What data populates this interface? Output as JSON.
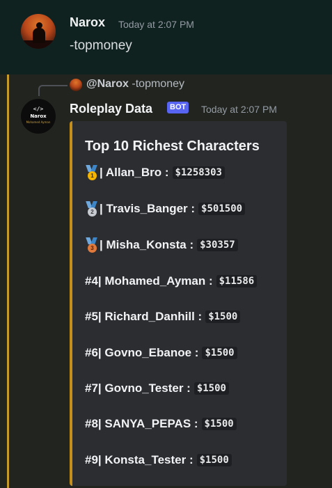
{
  "message1": {
    "author": "Narox",
    "timestamp": "Today at 2:07 PM",
    "content": "-topmoney"
  },
  "message2": {
    "reply": {
      "author": "@Narox",
      "content": "-topmoney"
    },
    "author": "Roleplay Data",
    "badge": "BOT",
    "timestamp": "Today at 2:07 PM",
    "avatar": {
      "code": "</>",
      "name": "Narox",
      "sub": "Mohamed Ayman"
    },
    "embed": {
      "title": "Top 10 Richest Characters",
      "accent_color": "#c58d1a",
      "rows": [
        {
          "rank": "| Allan_Bro :",
          "amount": "$1258303",
          "medal": "gold-medal",
          "medal_num": "1"
        },
        {
          "rank": "| Travis_Banger :",
          "amount": "$501500",
          "medal": "silver-medal",
          "medal_num": "2"
        },
        {
          "rank": "| Misha_Konsta :",
          "amount": "$30357",
          "medal": "bronze-medal",
          "medal_num": "3"
        },
        {
          "rank": "#4| Mohamed_Ayman :",
          "amount": "$11586"
        },
        {
          "rank": "#5| Richard_Danhill :",
          "amount": "$1500"
        },
        {
          "rank": "#6| Govno_Ebanoe :",
          "amount": "$1500"
        },
        {
          "rank": "#7| Govno_Tester :",
          "amount": "$1500"
        },
        {
          "rank": "#8| SANYA_PEPAS :",
          "amount": "$1500"
        },
        {
          "rank": "#9| Konsta_Tester :",
          "amount": "$1500"
        }
      ]
    }
  }
}
